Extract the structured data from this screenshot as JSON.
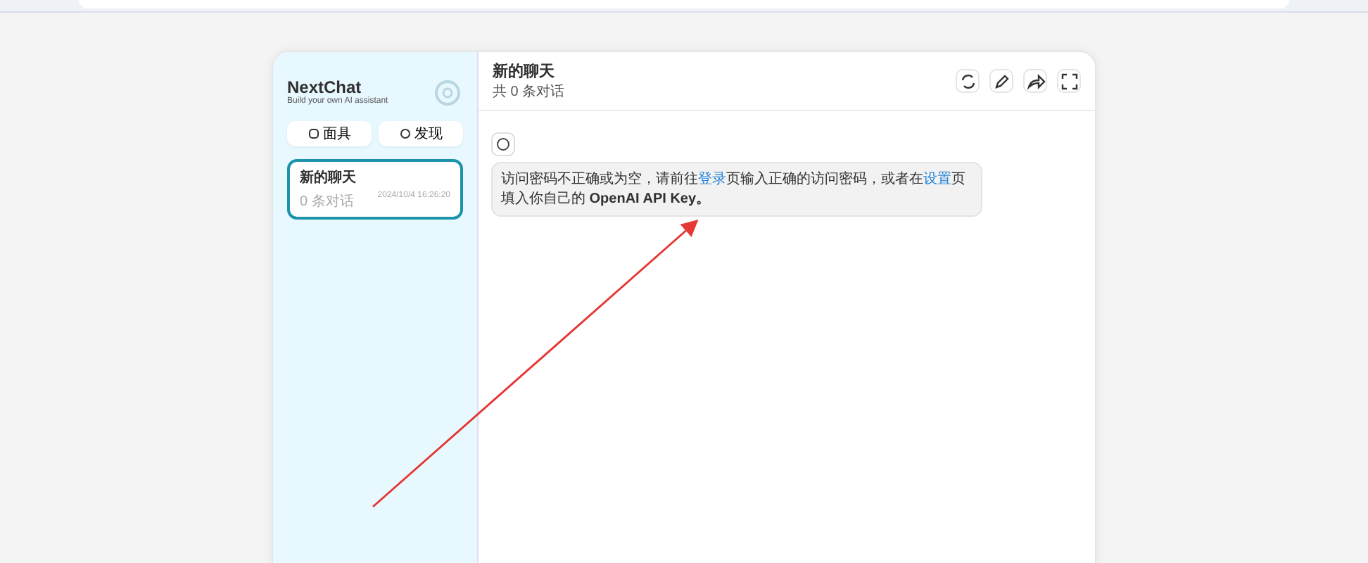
{
  "sidebar": {
    "title": "NextChat",
    "subtitle": "Build your own AI assistant",
    "buttons": [
      {
        "label": "面具",
        "kind": "mask"
      },
      {
        "label": "发现",
        "kind": "discover"
      }
    ],
    "chats": [
      {
        "title": "新的聊天",
        "count": "0 条对话",
        "time": "2024/10/4 16:26:20",
        "selected": true
      }
    ]
  },
  "chat": {
    "title": "新的聊天",
    "subtitle": "共 0 条对话",
    "actions": [
      {
        "kind": "refresh"
      },
      {
        "kind": "edit"
      },
      {
        "kind": "share"
      },
      {
        "kind": "fullscreen"
      }
    ],
    "messages": [
      {
        "segments": [
          {
            "kind": "text",
            "text": "访问密码不正确或为空，请前往"
          },
          {
            "kind": "link",
            "text": "登录"
          },
          {
            "kind": "text",
            "text": "页输入正确的访问密码，或者在"
          },
          {
            "kind": "link",
            "text": "设置"
          },
          {
            "kind": "text",
            "text": "页填入你自己的 "
          },
          {
            "kind": "bold",
            "text": "OpenAI API Key。"
          }
        ]
      }
    ]
  }
}
